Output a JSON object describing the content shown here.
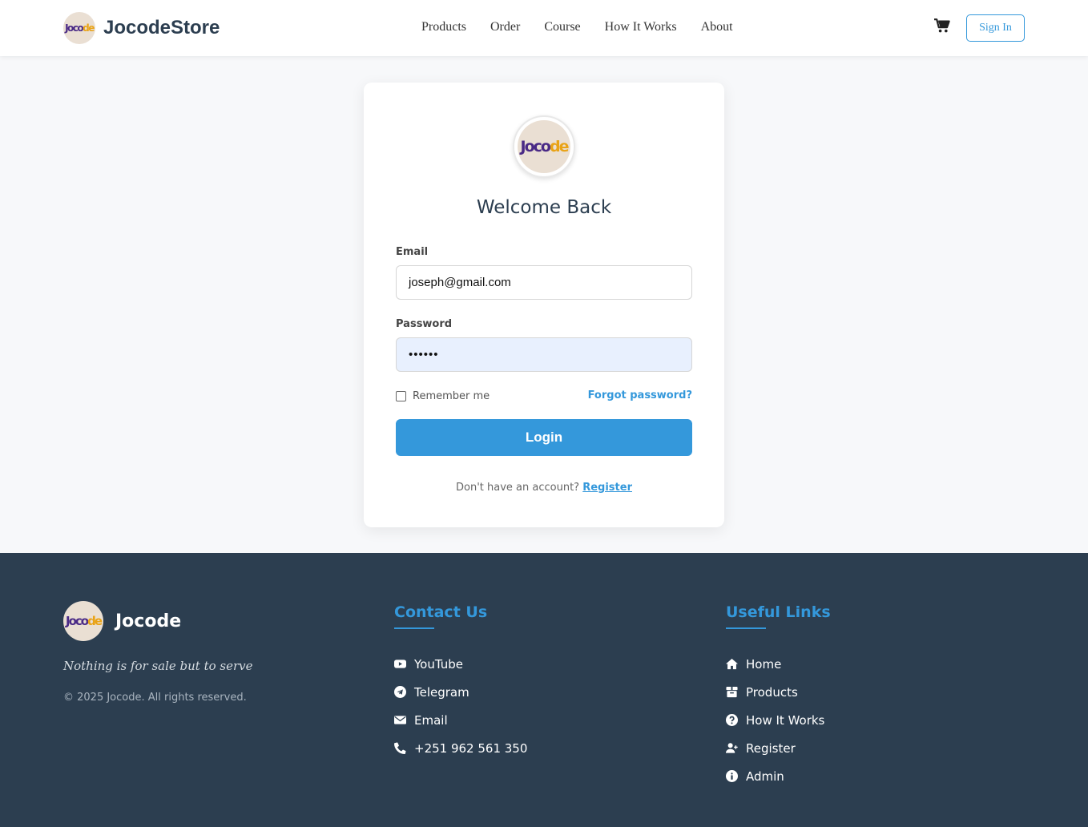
{
  "header": {
    "brand": "JocodeStore",
    "nav": [
      "Products",
      "Order",
      "Course",
      "How It Works",
      "About"
    ],
    "signin": "Sign In",
    "cart_icon": "shopping-cart-icon"
  },
  "logo": {
    "part1": "Joco",
    "part2": "de"
  },
  "login": {
    "title": "Welcome Back",
    "email_label": "Email",
    "email_value": "joseph@gmail.com",
    "password_label": "Password",
    "password_value": "••••••",
    "remember": "Remember me",
    "forgot": "Forgot password?",
    "button": "Login",
    "no_account": "Don't have an account?",
    "register": "Register"
  },
  "footer": {
    "brand": "Jocode",
    "tagline": "Nothing is for sale but to serve",
    "copyright": "© 2025 Jocode. All rights reserved.",
    "contact_title": "Contact Us",
    "contact": [
      {
        "label": "YouTube",
        "icon": "youtube-icon"
      },
      {
        "label": "Telegram",
        "icon": "telegram-icon"
      },
      {
        "label": "Email",
        "icon": "envelope-icon"
      },
      {
        "label": "+251 962 561 350",
        "icon": "phone-icon"
      }
    ],
    "links_title": "Useful Links",
    "links": [
      {
        "label": "Home",
        "icon": "home-icon"
      },
      {
        "label": "Products",
        "icon": "box-icon"
      },
      {
        "label": "How It Works",
        "icon": "question-circle-icon"
      },
      {
        "label": "Register",
        "icon": "user-plus-icon"
      },
      {
        "label": "Admin",
        "icon": "info-circle-icon"
      }
    ]
  },
  "colors": {
    "accent": "#3498db",
    "footer_bg": "#2c3e50",
    "page_bg": "#f7f8fa"
  }
}
